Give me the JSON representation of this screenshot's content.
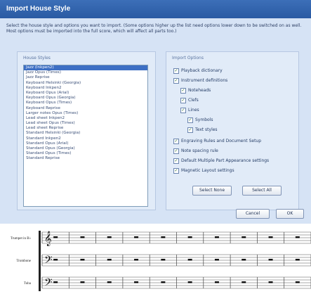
{
  "window": {
    "title": "Import House Style"
  },
  "intro": "Select the house style and options you want to import. (Some options higher up the list need options lower down to be switched on as well. Most options must be imported into the full score, which will affect all parts too.)",
  "house_styles": {
    "label": "House Styles",
    "items": [
      "Jazz (Inkpen2)",
      "Jazz Opus (Times)",
      "Jazz Reprise",
      "Keyboard Helsinki (Georgia)",
      "Keyboard Inkpen2",
      "Keyboard Opus (Arial)",
      "Keyboard Opus (Georgia)",
      "Keyboard Opus (Times)",
      "Keyboard Reprise",
      "Larger notes Opus (Times)",
      "Lead sheet Inkpen2",
      "Lead sheet Opus (Times)",
      "Lead sheet Reprise",
      "Standard Helsinki (Georgia)",
      "Standard Inkpen2",
      "Standard Opus (Arial)",
      "Standard Opus (Georgia)",
      "Standard Opus (Times)",
      "Standard Reprise"
    ],
    "selected_index": 0
  },
  "import_options": {
    "label": "Import Options",
    "items": [
      {
        "label": "Playback dictionary",
        "checked": true
      },
      {
        "label": "Instrument definitions",
        "checked": true
      },
      {
        "label": "Noteheads",
        "checked": true
      },
      {
        "label": "Clefs",
        "checked": true
      },
      {
        "label": "Lines",
        "checked": true
      },
      {
        "label": "Symbols",
        "checked": true
      },
      {
        "label": "Text styles",
        "checked": true
      },
      {
        "label": "Engraving Rules and Document Setup",
        "checked": true
      },
      {
        "label": "Note spacing rule",
        "checked": true
      },
      {
        "label": "Default Multiple Part Appearance settings",
        "checked": true
      },
      {
        "label": "Magnetic Layout settings",
        "checked": true
      }
    ],
    "select_none": "Select None",
    "select_all": "Select All"
  },
  "buttons": {
    "cancel": "Cancel",
    "ok": "OK"
  },
  "score": {
    "staves": [
      "Trumpet in B♭",
      "Trombone",
      "Tuba"
    ],
    "bars": 10
  }
}
